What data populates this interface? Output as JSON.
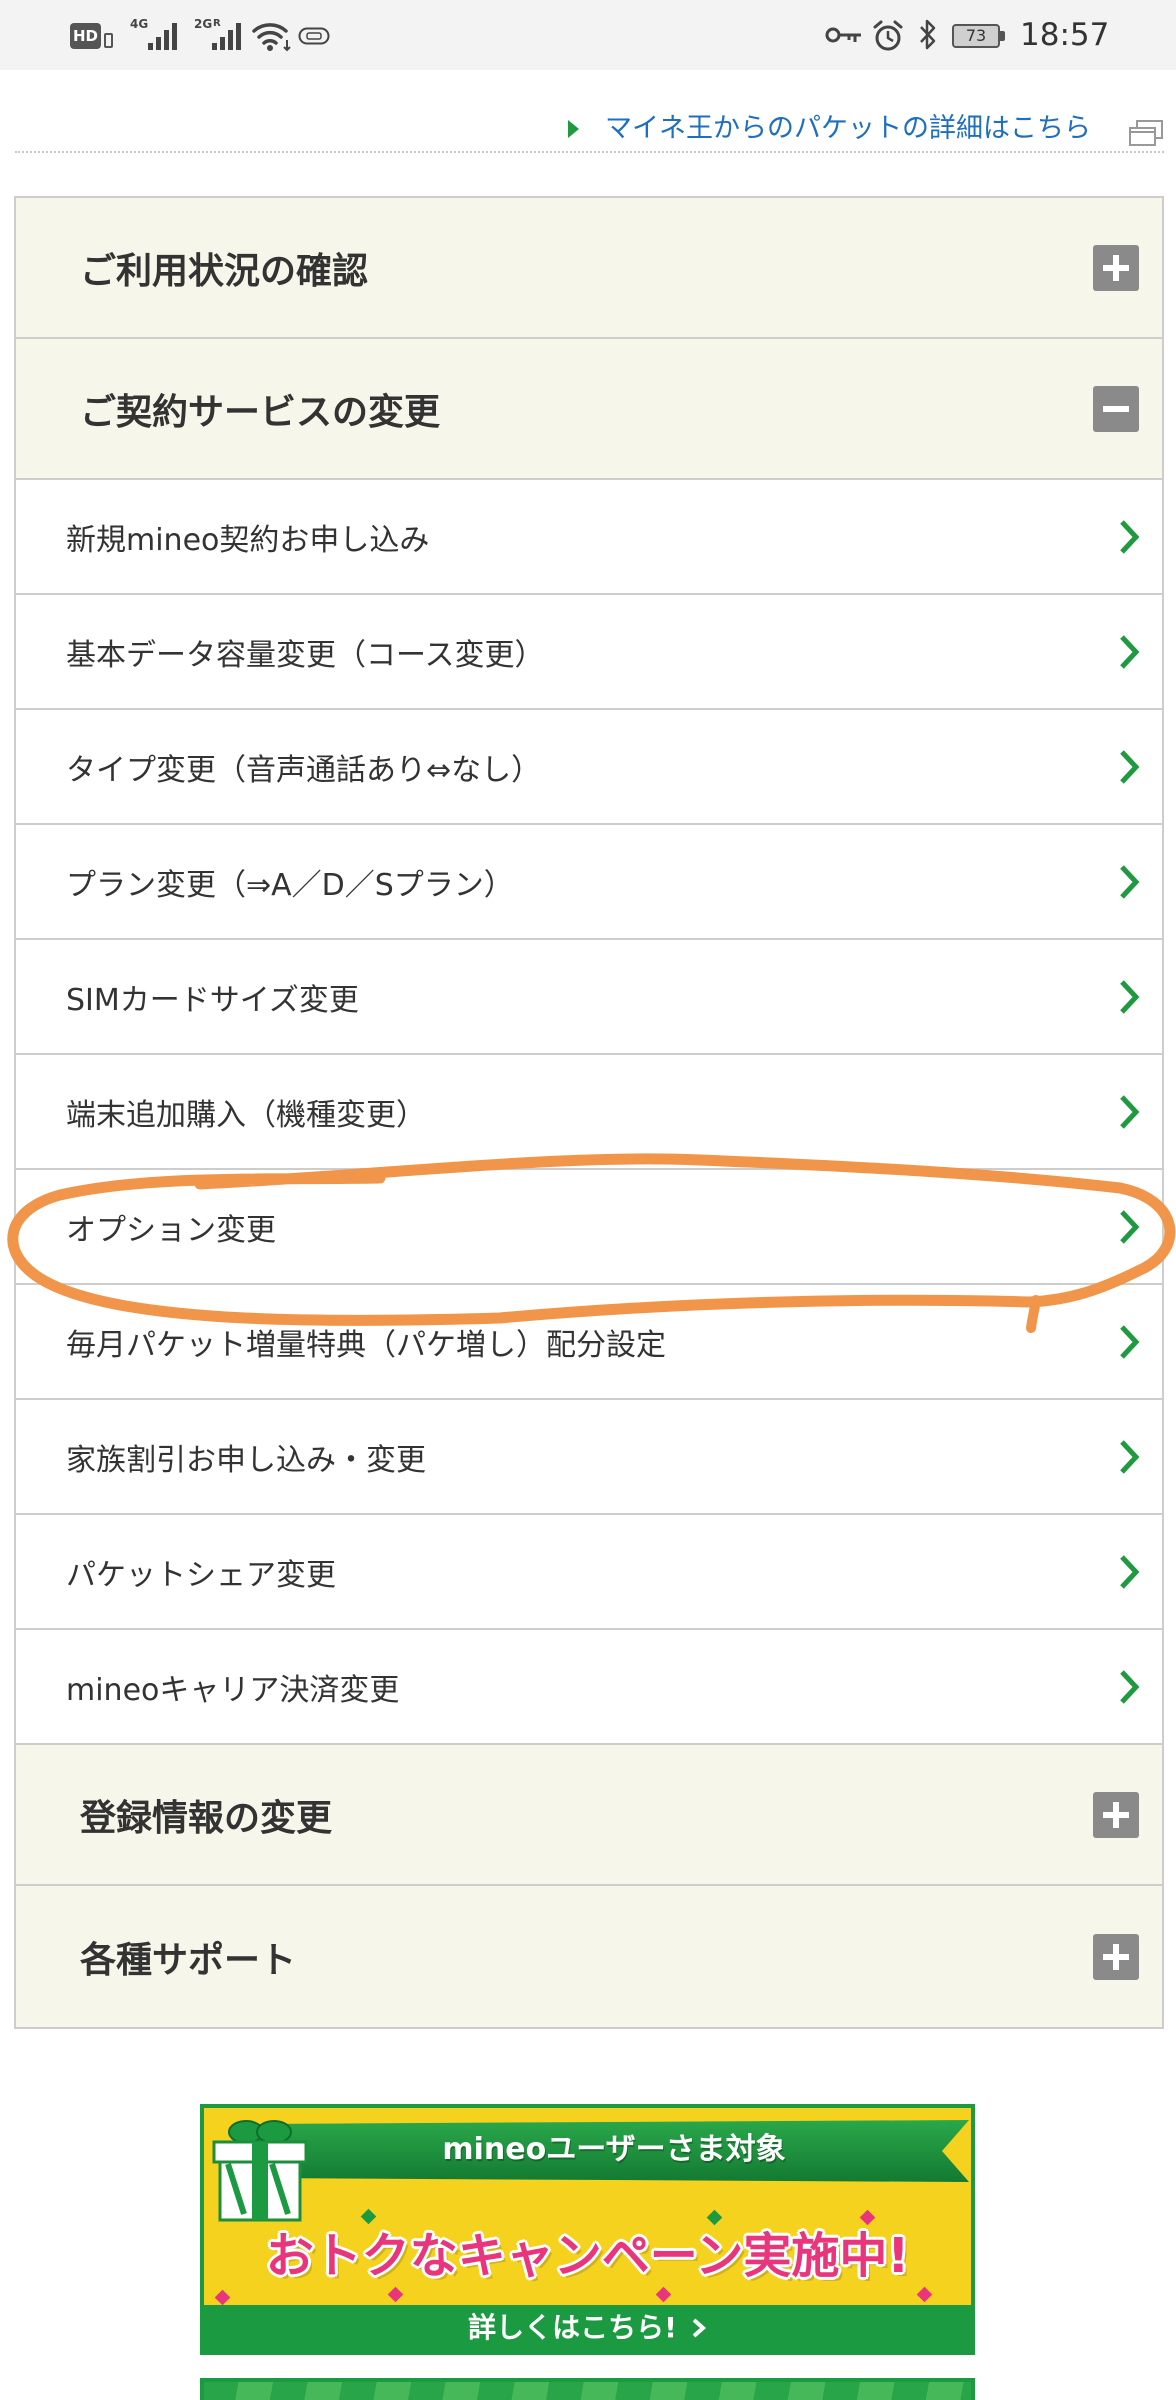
{
  "status_bar": {
    "hd_badge": "HD",
    "sim1_network": "4G",
    "sim2_network": "2G",
    "sim2_roaming": "R",
    "battery_level": "73",
    "time": "18:57",
    "left_icons": [
      "hd-icon",
      "signal-icon",
      "signal-icon",
      "wifi-icon",
      "nfc-icon"
    ],
    "right_icons": [
      "vpn-key-icon",
      "alarm-icon",
      "bluetooth-icon",
      "battery-icon"
    ]
  },
  "packet_link": {
    "label": "マイネ王からのパケットの詳細はこちら",
    "lead_icon": "triangle-right-icon",
    "trailing_icon": "external-window-icon"
  },
  "menu": {
    "item_icon": "chevron-right-icon",
    "sections": [
      {
        "title": "ご利用状況の確認",
        "expanded": false,
        "toggle_icon": "plus-icon"
      },
      {
        "title": "ご契約サービスの変更",
        "expanded": true,
        "toggle_icon": "minus-icon",
        "items": [
          "新規mineo契約お申し込み",
          "基本データ容量変更（コース変更）",
          "タイプ変更（音声通話あり⇔なし）",
          "プラン変更（⇒A／D／Sプラン）",
          "SIMカードサイズ変更",
          "端末追加購入（機種変更）",
          "オプション変更",
          "毎月パケット増量特典（パケ増し）配分設定",
          "家族割引お申し込み・変更",
          "パケットシェア変更",
          "mineoキャリア決済変更"
        ]
      },
      {
        "title": "登録情報の変更",
        "expanded": false,
        "toggle_icon": "plus-icon"
      },
      {
        "title": "各種サポート",
        "expanded": false,
        "toggle_icon": "plus-icon"
      }
    ]
  },
  "banner": {
    "ribbon": "mineoユーザーさま対象",
    "headline": "おトクなキャンペーン実施中!",
    "cta": "詳しくはこちら!",
    "cta_icon": "chevron-right-icon",
    "image_icon": "gift-box-icon"
  },
  "annotation": {
    "color": "#f0954a"
  },
  "colors": {
    "accent_green": "#1f9a40",
    "link_blue": "#1e6fc0",
    "section_bg": "#f6f6ea",
    "divider": "#cdcdcd",
    "toggle_gray": "#8a8a8a",
    "text": "#333333",
    "status_bar_bg": "#f3f3f3",
    "banner_yellow": "#f5d21e",
    "banner_green": "#1c9a41",
    "banner_pink": "#e8357b"
  }
}
